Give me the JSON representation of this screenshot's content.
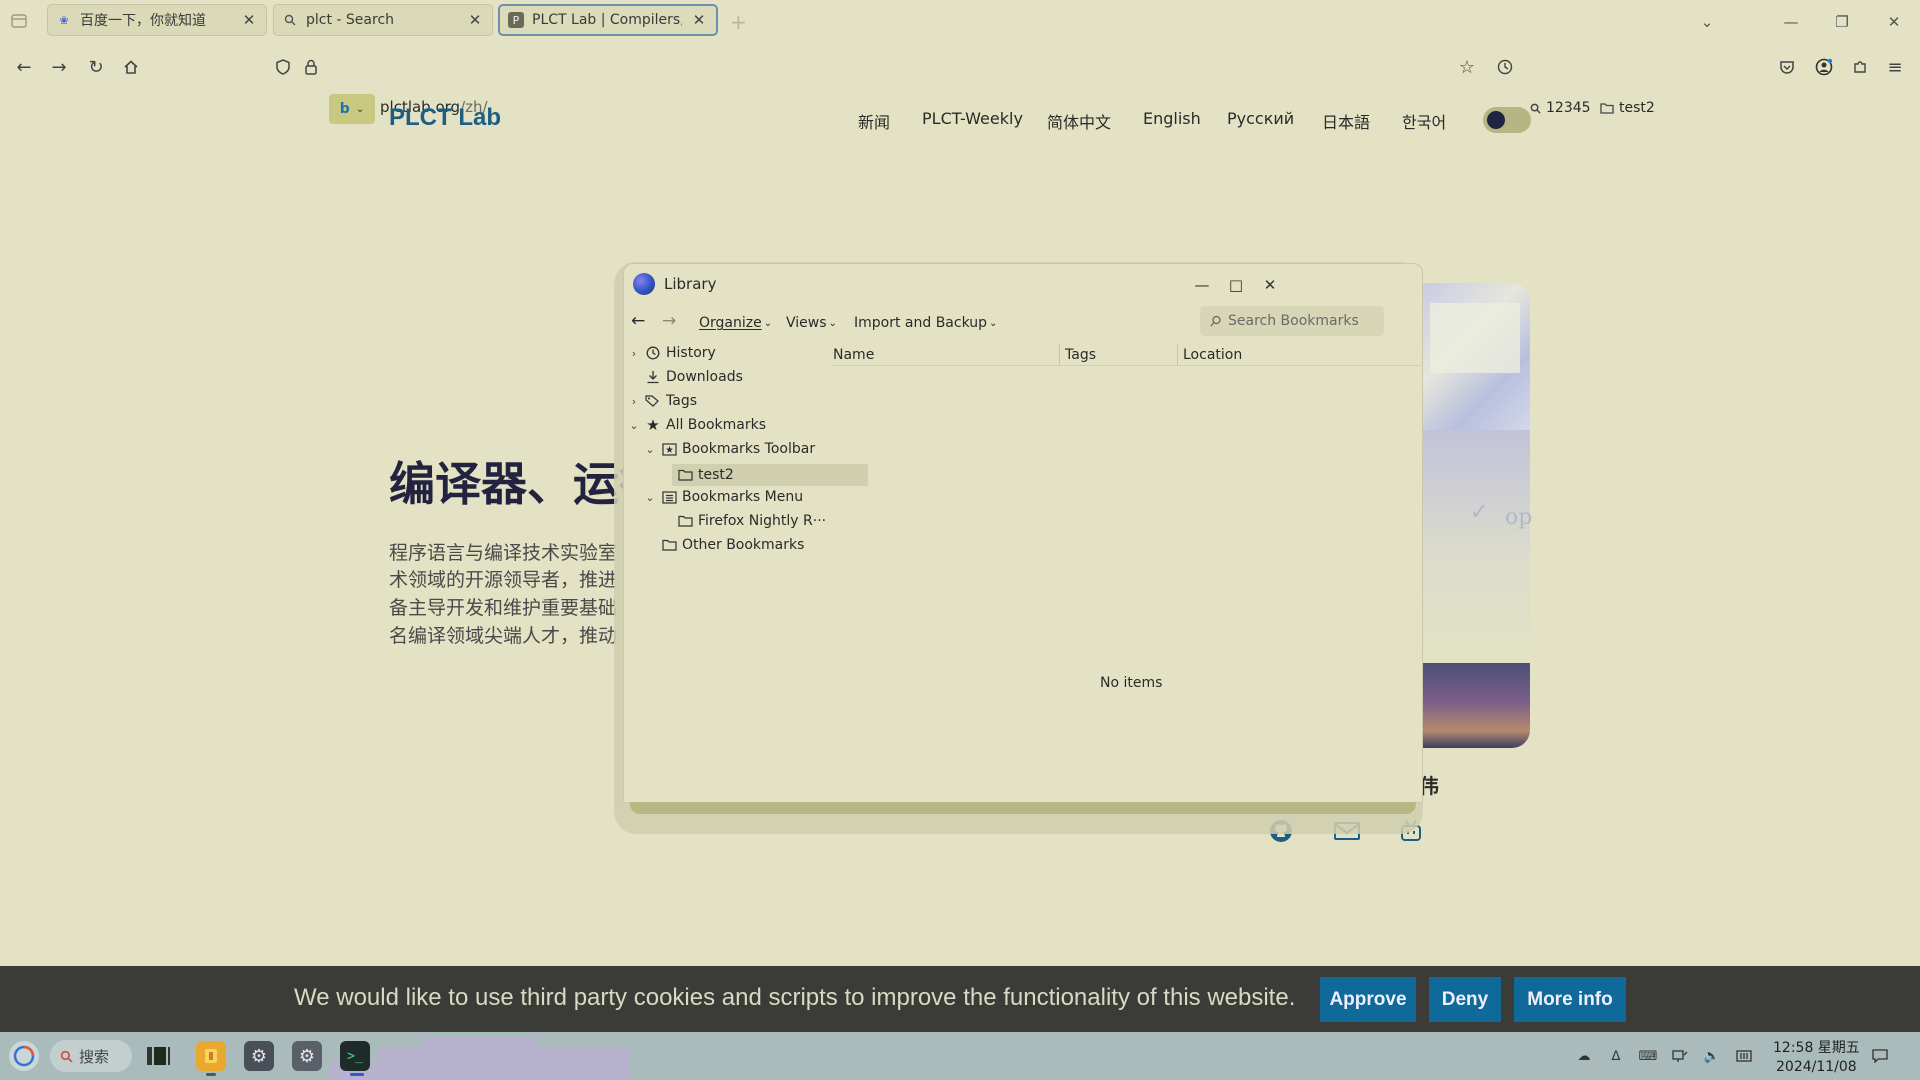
{
  "browser": {
    "tabs": [
      {
        "title": "百度一下，你就知道",
        "favicon": "paw-icon"
      },
      {
        "title": "plct - Search",
        "favicon": "search-icon"
      },
      {
        "title": "PLCT Lab | Compilers, Run",
        "favicon": "plct-icon",
        "favicon_letter": "P",
        "active": true
      }
    ],
    "url_host": "plctlab.org",
    "url_path": "/zh/",
    "toolbar_search": "12345",
    "toolbar_folder": "test2"
  },
  "site": {
    "logo": "PLCT Lab",
    "nav": [
      "新闻",
      "PLCT-Weekly",
      "简体中文",
      "English",
      "Русский",
      "日本語",
      "한국어"
    ],
    "hero_title": "编译器、运行",
    "hero_lines": [
      "程序语言与编译技术实验室",
      "术领域的开源领导者，推进",
      "备主导开发和维护重要基础",
      "名编译领域尖端人才，推动"
    ],
    "photo_text": "op",
    "name_fragment": "伟"
  },
  "library": {
    "title": "Library",
    "organize": "Organize",
    "views": "Views",
    "import_backup": "Import and Backup",
    "search_placeholder": "Search Bookmarks",
    "tree": {
      "history": "History",
      "downloads": "Downloads",
      "tags": "Tags",
      "all_bookmarks": "All Bookmarks",
      "bookmarks_toolbar": "Bookmarks Toolbar",
      "test2": "test2",
      "bookmarks_menu": "Bookmarks Menu",
      "firefox_nightly": "Firefox Nightly R···",
      "other_bookmarks": "Other Bookmarks"
    },
    "columns": {
      "name": "Name",
      "tags": "Tags",
      "location": "Location"
    },
    "empty_text": "No items"
  },
  "cookie": {
    "message": "We would like to use third party cookies and scripts to improve the functionality of this website.",
    "approve": "Approve",
    "deny": "Deny",
    "more_info": "More info"
  },
  "taskbar": {
    "search": "搜索",
    "time": "12:58 星期五",
    "date": "2024/11/08"
  },
  "colors": {
    "accent": "#0f6a99",
    "logo": "#1d5e83",
    "background": "#e3e2c4"
  }
}
